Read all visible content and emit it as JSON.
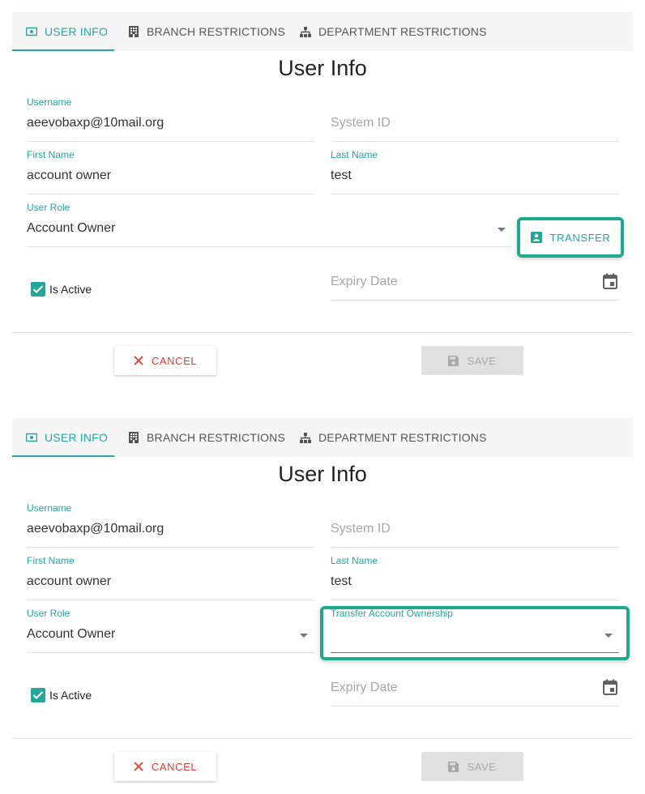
{
  "colors": {
    "accent": "#26a69a",
    "cancel": "#e53935",
    "highlight": "#1faa8c"
  },
  "tabs": [
    {
      "label": "USER INFO",
      "icon": "id-card-icon"
    },
    {
      "label": "BRANCH RESTRICTIONS",
      "icon": "building-icon"
    },
    {
      "label": "DEPARTMENT RESTRICTIONS",
      "icon": "sitemap-icon"
    }
  ],
  "title": "User Info",
  "fields": {
    "username_label": "Username",
    "username_value": "aeevobaxp@10mail.org",
    "system_id_placeholder": "System ID",
    "first_name_label": "First Name",
    "first_name_value": "account owner",
    "last_name_label": "Last Name",
    "last_name_value": "test",
    "user_role_label": "User Role",
    "user_role_value": "Account Owner",
    "is_active_label": "Is Active",
    "expiry_date_placeholder": "Expiry Date",
    "transfer_ownership_label": "Transfer Account Ownership"
  },
  "buttons": {
    "transfer": "TRANSFER",
    "cancel": "CANCEL",
    "save": "SAVE"
  }
}
